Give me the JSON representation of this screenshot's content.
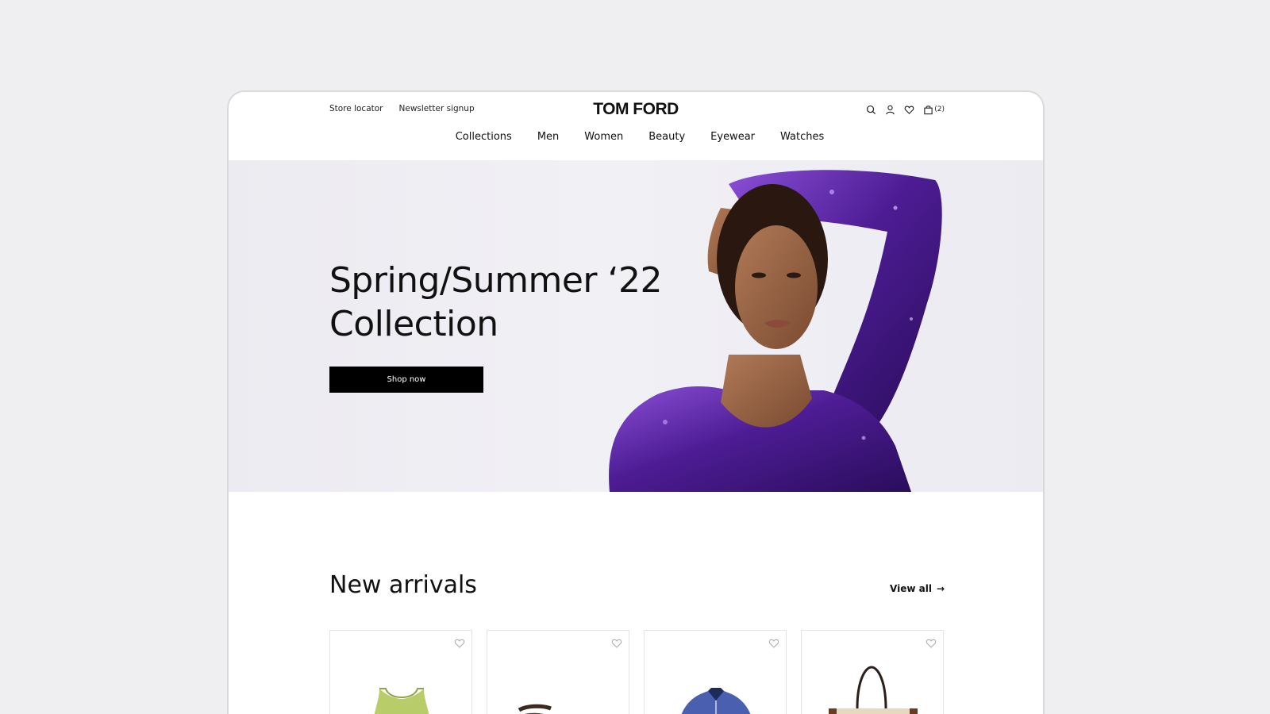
{
  "header": {
    "util_links": [
      "Store locator",
      "Newsletter signup"
    ],
    "logo": "TOM FORD",
    "icons": [
      "search-icon",
      "user-icon",
      "heart-icon",
      "bag-icon"
    ],
    "cart_count": "(2)",
    "nav": [
      "Collections",
      "Men",
      "Women",
      "Beauty",
      "Eyewear",
      "Watches"
    ]
  },
  "hero": {
    "title_line1": "Spring/Summer ‘22",
    "title_line2": "Collection",
    "cta_label": "Shop now",
    "image": "model-in-purple-sequin-dress"
  },
  "arrivals": {
    "title": "New arrivals",
    "view_all_label": "View all",
    "products": [
      {
        "image": "green-metallic-tank-top"
      },
      {
        "image": "brown-wrap-bracelet"
      },
      {
        "image": "blue-sequin-jacket"
      },
      {
        "image": "canvas-tote-bag"
      }
    ]
  },
  "colors": {
    "accent_purple": "#5b2a9e",
    "cta_bg": "#000000",
    "hero_bg": "#efeef3"
  }
}
